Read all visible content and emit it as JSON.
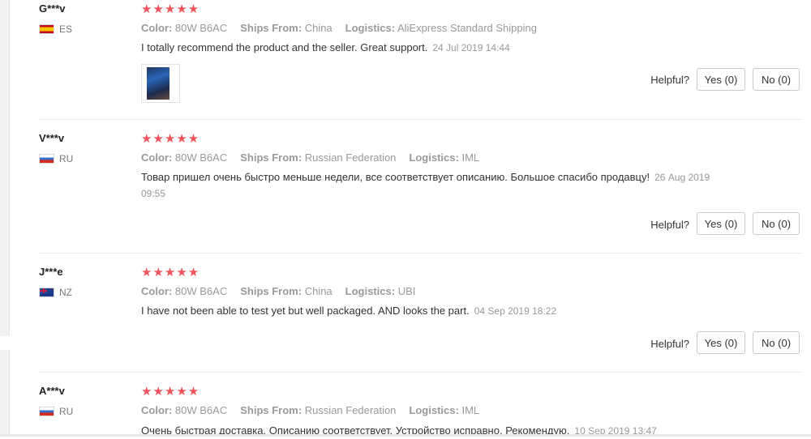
{
  "reviews": [
    {
      "user": "G***v",
      "country": "ES",
      "stars": "★★★★★",
      "color_label": "Color:",
      "color": "80W B6AC",
      "ships_label": "Ships From:",
      "ships": "China",
      "logistics_label": "Logistics:",
      "logistics": "AliExpress Standard Shipping",
      "text": "I totally recommend the product and the seller. Great support.",
      "date": "24 Jul 2019 14:44",
      "helpful_label": "Helpful?",
      "yes": "Yes (0)",
      "no": "No (0)"
    },
    {
      "user": "V***v",
      "country": "RU",
      "stars": "★★★★★",
      "color_label": "Color:",
      "color": "80W B6AC",
      "ships_label": "Ships From:",
      "ships": "Russian Federation",
      "logistics_label": "Logistics:",
      "logistics": "IML",
      "text": "Товар пришел очень быстро меньше недели, все соответствует описанию. Большое спасибо продавцу!",
      "date": "26 Aug 2019 09:55",
      "helpful_label": "Helpful?",
      "yes": "Yes (0)",
      "no": "No (0)"
    },
    {
      "user": "J***e",
      "country": "NZ",
      "stars": "★★★★★",
      "color_label": "Color:",
      "color": "80W B6AC",
      "ships_label": "Ships From:",
      "ships": "China",
      "logistics_label": "Logistics:",
      "logistics": "UBI",
      "text": "I have not been able to test yet but well packaged. AND looks the part.",
      "date": "04 Sep 2019 18:22",
      "helpful_label": "Helpful?",
      "yes": "Yes (0)",
      "no": "No (0)"
    },
    {
      "user": "A***v",
      "country": "RU",
      "stars": "★★★★★",
      "color_label": "Color:",
      "color": "80W B6AC",
      "ships_label": "Ships From:",
      "ships": "Russian Federation",
      "logistics_label": "Logistics:",
      "logistics": "IML",
      "text": "Очень быстрая доставка. Описанию соответствует. Устройство исправно. Рекомендую.",
      "date": "10 Sep 2019 13:47"
    }
  ],
  "colors": {
    "star": "#f2545b",
    "muted": "#999999",
    "border": "#c9c9c9"
  }
}
